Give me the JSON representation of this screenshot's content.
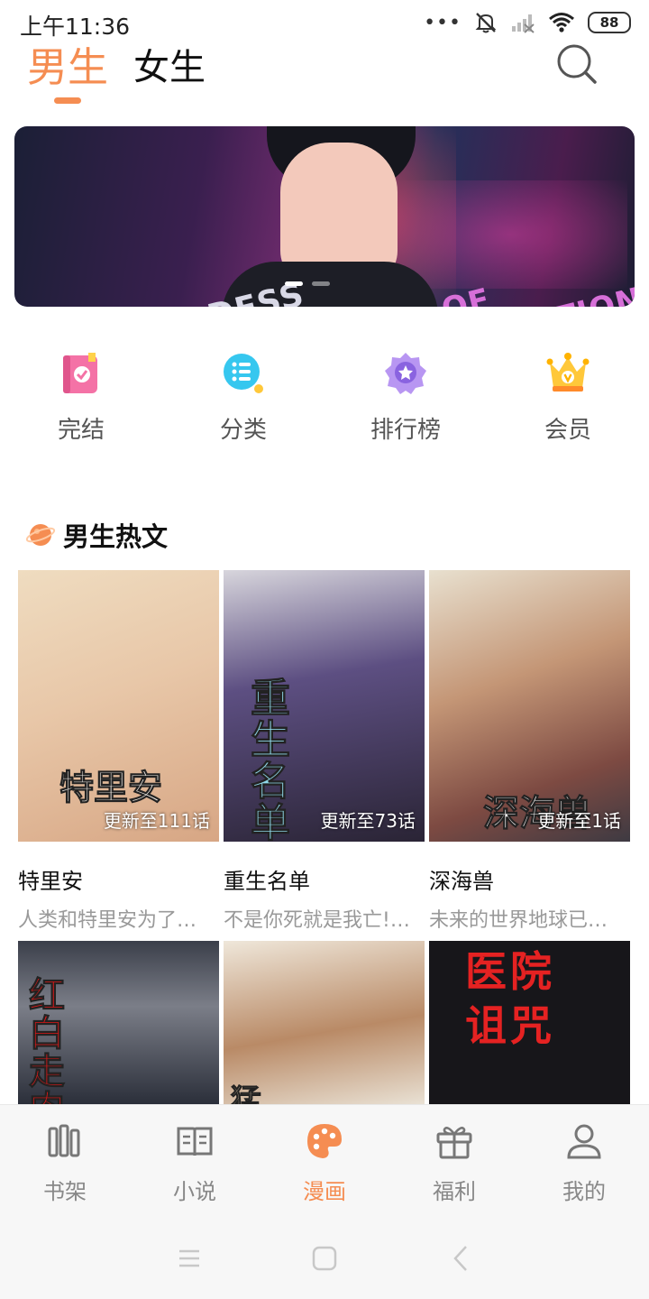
{
  "status_bar": {
    "time": "上午11:36",
    "signal_dots": "•••",
    "battery": "88"
  },
  "gender_tabs": [
    {
      "label": "男生",
      "active": true
    },
    {
      "label": "女生",
      "active": false
    }
  ],
  "banner": {
    "text_left": "GODDESS",
    "text_right": "OF SALVATION",
    "slides_total": 2,
    "active_slide": 1
  },
  "quick_entries": [
    {
      "label": "完结",
      "icon": "book-check-icon"
    },
    {
      "label": "分类",
      "icon": "list-category-icon"
    },
    {
      "label": "排行榜",
      "icon": "medal-icon"
    },
    {
      "label": "会员",
      "icon": "crown-icon"
    }
  ],
  "section": {
    "title": "男生热文",
    "icon": "planet-icon"
  },
  "comics": [
    {
      "name": "特里安",
      "desc": "人类和特里安为了生存而战...",
      "badge": "更新至111话",
      "cover_title": "特里安"
    },
    {
      "name": "重生名单",
      "desc": "不是你死就是我亡!重生名单",
      "badge": "更新至73话",
      "cover_title": "重生名单"
    },
    {
      "name": "深海兽",
      "desc": "未来的世界地球已经被海水...",
      "badge": "更新至1话",
      "cover_title": "深海兽"
    },
    {
      "name": "",
      "desc": "",
      "badge": "",
      "cover_title": "红白走肉"
    },
    {
      "name": "",
      "desc": "",
      "badge": "",
      "cover_title": "猛"
    },
    {
      "name": "",
      "desc": "",
      "badge": "",
      "cover_title": "医院诅咒"
    }
  ],
  "bottom_nav": [
    {
      "label": "书架",
      "icon": "bookshelf-icon",
      "active": false
    },
    {
      "label": "小说",
      "icon": "open-book-icon",
      "active": false
    },
    {
      "label": "漫画",
      "icon": "palette-icon",
      "active": true
    },
    {
      "label": "福利",
      "icon": "gift-icon",
      "active": false
    },
    {
      "label": "我的",
      "icon": "user-icon",
      "active": false
    }
  ],
  "colors": {
    "accent": "#f58d52",
    "text_primary": "#111111",
    "text_secondary": "#999999"
  }
}
